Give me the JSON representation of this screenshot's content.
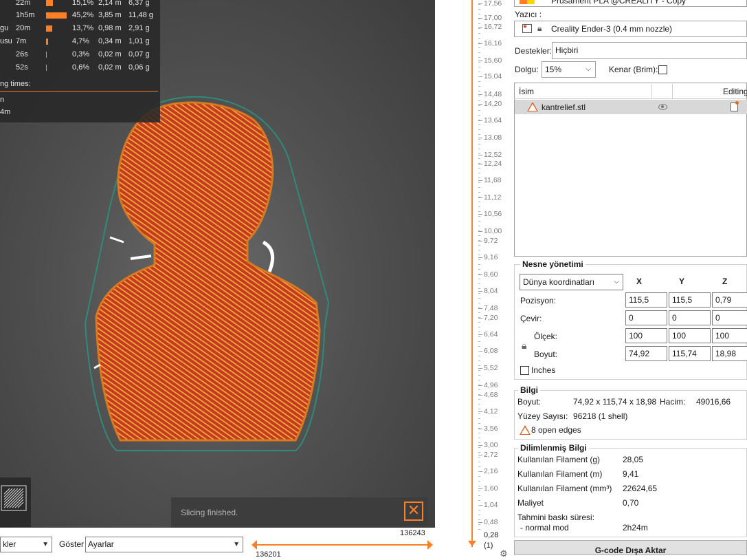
{
  "stats": {
    "rows": [
      {
        "name": "",
        "time": "22m",
        "pct": "15,1%",
        "meters": "2,14 m",
        "grams": "6,37 g",
        "fraction": 0.151
      },
      {
        "name": "",
        "time": "1h5m",
        "pct": "45,2%",
        "meters": "3,85 m",
        "grams": "11,48 g",
        "fraction": 0.452
      },
      {
        "name": "gu",
        "time": "20m",
        "pct": "13,7%",
        "meters": "0,98 m",
        "grams": "2,91 g",
        "fraction": 0.137
      },
      {
        "name": "usu",
        "time": "7m",
        "pct": "4,7%",
        "meters": "0,34 m",
        "grams": "1,01 g",
        "fraction": 0.047
      },
      {
        "name": "",
        "time": "26s",
        "pct": "0,3%",
        "meters": "0,02 m",
        "grams": "0,07 g",
        "fraction": 0.003
      },
      {
        "name": "",
        "time": "52s",
        "pct": "0,6%",
        "meters": "0,02 m",
        "grams": "0,06 g",
        "fraction": 0.006
      }
    ],
    "times_label": "ng times:",
    "extra1": "n",
    "extra2": "4m"
  },
  "notification": {
    "text": "Slicing finished.",
    "close_icon": "close-x-icon"
  },
  "bottom": {
    "view_value": "kler",
    "show_label": "Göster",
    "show_value": "Ayarlar",
    "hslider_top": "136243",
    "hslider_bottom": "136201"
  },
  "vslider": {
    "ticks": [
      "17,56",
      "17,00",
      "16,72",
      "16,16",
      "15,60",
      "15,04",
      "14,48",
      "14,20",
      "13,64",
      "13,08",
      "12,52",
      "12,24",
      "11,68",
      "11,12",
      "10,56",
      "10,00",
      "9,72",
      "9,16",
      "8,60",
      "8,04",
      "7,48",
      "7,20",
      "6,64",
      "6,08",
      "5,52",
      "4,96",
      "4,68",
      "4,12",
      "3,56",
      "3,00",
      "2,72",
      "2,16",
      "1,60",
      "1,04",
      "0,48"
    ],
    "value_top": "0,28",
    "value_bottom": "(1)"
  },
  "panel": {
    "filament": "Prusament PLA @CREALITY - Copy",
    "printer_label": "Yazıcı :",
    "printer": "Creality Ender-3 (0.4 mm nozzle)",
    "supports_label": "Destekler:",
    "supports": "Hiçbiri",
    "infill_label": "Dolgu:",
    "infill": "15%",
    "brim_label": "Kenar (Brim):",
    "list": {
      "col_name": "İsim",
      "col_editing": "Editing",
      "object": "kantrelief.stl"
    },
    "obj_mgmt": {
      "title": "Nesne yönetimi",
      "coord_system": "Dünya koordinatları",
      "axes": [
        "X",
        "Y",
        "Z"
      ],
      "position_label": "Pozisyon:",
      "position": [
        "115,5",
        "115,5",
        "0,79"
      ],
      "rotate_label": "Çevir:",
      "rotate": [
        "0",
        "0",
        "0"
      ],
      "scale_label": "Ölçek:",
      "scale": [
        "100",
        "100",
        "100"
      ],
      "size_label": "Boyut:",
      "size": [
        "74,92",
        "115,74",
        "18,98"
      ],
      "inches_label": "Inches"
    },
    "info": {
      "title": "Bilgi",
      "size_label": "Boyut:",
      "size": "74,92 x 115,74 x 18,98",
      "volume_label": "Hacim:",
      "volume": "49016,66",
      "facets_label": "Yüzey Sayısı:",
      "facets": "96218 (1 shell)",
      "open_edges": "8 open edges"
    },
    "sliced": {
      "title": "Dilimlenmiş Bilgi",
      "filament_g_label": "Kullanılan Filament (g)",
      "filament_g": "28,05",
      "filament_m_label": "Kullanılan Filament (m)",
      "filament_m": "9,41",
      "filament_mm3_label": "Kullanılan Filament (mm³)",
      "filament_mm3": "22624,65",
      "cost_label": "Maliyet",
      "cost": "0,70",
      "est_time_label": "Tahmini baskı süresi:",
      "normal_mode_label": "- normal mod",
      "normal_mode": "2h24m"
    },
    "export_button": "G-code Dışa Aktar"
  },
  "colors": {
    "accent": "#ff7f27",
    "model_fill": "#c8302a",
    "model_lines": "#e8b030",
    "bed_outline": "#2f8a78"
  }
}
